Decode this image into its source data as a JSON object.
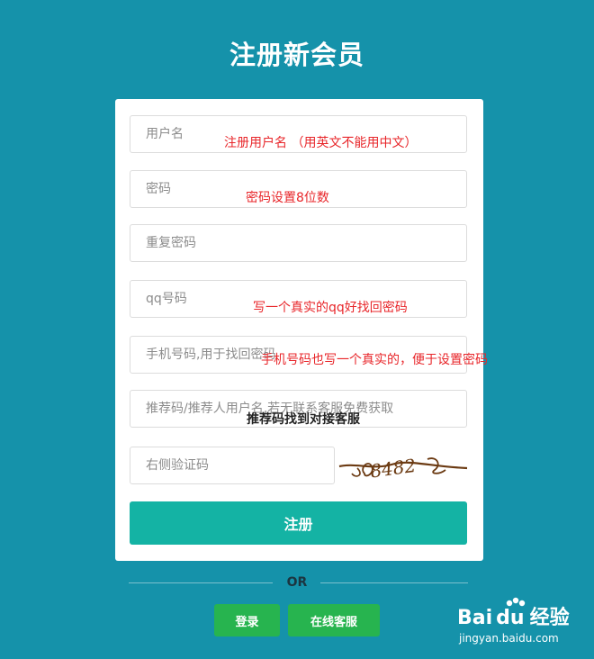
{
  "page": {
    "title": "注册新会员"
  },
  "form": {
    "username_placeholder": "用户名",
    "password_placeholder": "密码",
    "repeat_password_placeholder": "重复密码",
    "qq_placeholder": "qq号码",
    "phone_placeholder": "手机号码,用于找回密码",
    "referral_placeholder": "推荐码/推荐人用户名,若无联系客服免费获取",
    "captcha_placeholder": "右侧验证码",
    "captcha_text": "8482",
    "submit_label": "注册"
  },
  "annotations": {
    "username_note": "注册用户名  （用英文不能用中文）",
    "password_note": "密码设置8位数",
    "qq_note": "写一个真实的qq好找回密码",
    "phone_note": "手机号码也写一个真实的，便于设置密码",
    "referral_note": "推荐码找到对接客服"
  },
  "footer": {
    "or_text": "OR",
    "login_label": "登录",
    "support_label": "在线客服"
  },
  "watermark": {
    "logo_text_a": "Bai",
    "logo_text_b": "du",
    "logo_text_c": "经验",
    "url": "jingyan.baidu.com"
  },
  "colors": {
    "background": "#1592aa",
    "submit_button": "#14b3a4",
    "footer_buttons": "#27b44f",
    "annotation_red": "#e8262a"
  }
}
